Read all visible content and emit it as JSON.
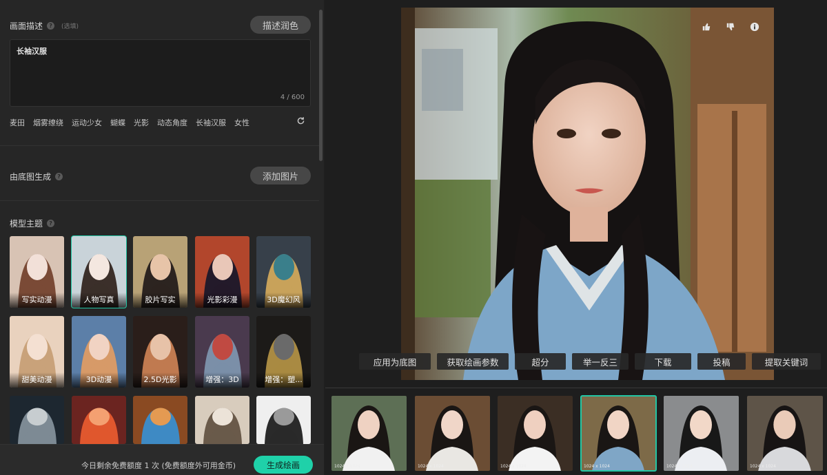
{
  "description": {
    "title": "画面描述",
    "optional": "(选填)",
    "polish_button": "描述润色",
    "value": "长袖汉服",
    "counter": "4 / 600",
    "tags": [
      "麦田",
      "烟雾缭绕",
      "运动少女",
      "蝴蝶",
      "光影",
      "动态角度",
      "长袖汉服",
      "女性"
    ]
  },
  "base_image": {
    "title": "由底图生成",
    "add_button": "添加图片"
  },
  "model_theme": {
    "title": "模型主题",
    "items": [
      {
        "label": "写实动漫",
        "selected": false
      },
      {
        "label": "人物写真",
        "selected": true
      },
      {
        "label": "胶片写实",
        "selected": false
      },
      {
        "label": "光影彩漫",
        "selected": false
      },
      {
        "label": "3D魔幻风",
        "selected": false
      },
      {
        "label": "甜美动漫",
        "selected": false
      },
      {
        "label": "3D动漫",
        "selected": false
      },
      {
        "label": "2.5D光影",
        "selected": false
      },
      {
        "label": "增强：3D",
        "selected": false
      },
      {
        "label": "增强：塑...",
        "selected": false
      },
      {
        "label": "",
        "selected": false
      },
      {
        "label": "",
        "selected": false
      },
      {
        "label": "",
        "selected": false
      },
      {
        "label": "",
        "selected": false
      },
      {
        "label": "",
        "selected": false
      }
    ]
  },
  "footer": {
    "quota": "今日剩余免费额度 1 次 (免费额度外可用金币)",
    "generate_button": "生成绘画"
  },
  "actions": [
    "应用为底图",
    "获取绘画参数",
    "超分",
    "举一反三",
    "下载",
    "投稿",
    "提取关键词"
  ],
  "history": [
    {
      "res": "1024 x 1024",
      "selected": false
    },
    {
      "res": "1024 x 1024",
      "selected": false
    },
    {
      "res": "1024 x 1024",
      "selected": false
    },
    {
      "res": "1024 x 1024",
      "selected": true
    },
    {
      "res": "1024 x 1024",
      "selected": false
    },
    {
      "res": "1024 x 1024",
      "selected": false
    }
  ],
  "colors": {
    "accent": "#1fd1a9"
  }
}
